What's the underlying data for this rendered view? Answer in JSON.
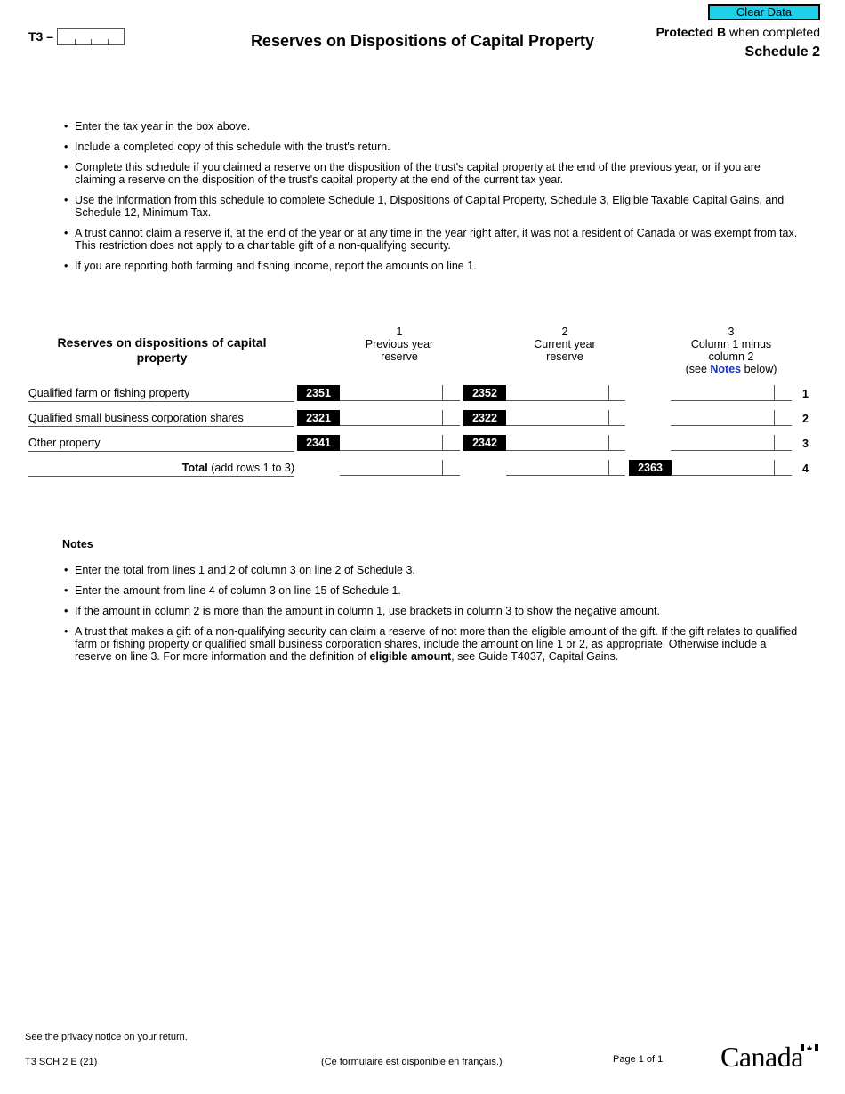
{
  "header": {
    "form_prefix": "T3 –",
    "tax_year_value": "",
    "title": "Reserves on Dispositions of Capital Property",
    "clear_button_label": "Clear Data",
    "protected_bold": "Protected B",
    "protected_rest": " when completed",
    "schedule": "Schedule 2"
  },
  "intro_bullets": [
    "Enter the tax year in the box above.",
    "Include a completed copy of this schedule with the trust's return.",
    "Complete this schedule if you claimed a reserve on the disposition of the trust's capital property at the end of the previous year, or if you are claiming a reserve on the disposition of the trust's capital property at the end of the current tax year.",
    "Use the information from this schedule to complete Schedule 1, Dispositions of Capital Property, Schedule 3, Eligible Taxable Capital Gains, and Schedule 12, Minimum Tax.",
    "A trust cannot claim a reserve if, at the end of the year or at any time in the year right after, it was not a resident of Canada or was exempt from tax. This restriction does not apply to a charitable gift of a non-qualifying security.",
    "If you are reporting both farming and fishing income, report the amounts on line 1."
  ],
  "table": {
    "title": "Reserves on dispositions of capital property",
    "columns": [
      {
        "num": "1",
        "line1": "Previous year",
        "line2": "reserve"
      },
      {
        "num": "2",
        "line1": "Current year",
        "line2": "reserve"
      },
      {
        "num": "3",
        "line1": "Column 1 minus",
        "line2": "column 2",
        "line3_pre": "(see ",
        "line3_link": "Notes",
        "line3_post": " below)"
      }
    ],
    "rows": [
      {
        "label": "Qualified farm or fishing property",
        "code1": "2351",
        "code2": "2352",
        "line": "1",
        "col1": "",
        "col2": "",
        "col3": ""
      },
      {
        "label": "Qualified small business corporation shares",
        "code1": "2321",
        "code2": "2322",
        "line": "2",
        "col1": "",
        "col2": "",
        "col3": ""
      },
      {
        "label": "Other property",
        "code1": "2341",
        "code2": "2342",
        "line": "3",
        "col1": "",
        "col2": "",
        "col3": ""
      }
    ],
    "total": {
      "label_bold": "Total",
      "label_rest": " (add rows 1 to 3)",
      "code3": "2363",
      "line": "4",
      "col1": "",
      "col2": "",
      "col3": ""
    }
  },
  "notes": {
    "title": "Notes",
    "items": [
      "Enter the total from lines 1 and 2 of column 3 on line 2 of Schedule 3.",
      "Enter the amount from line 4 of column 3 on line 15 of Schedule 1.",
      "If the amount in column 2 is more than the amount in column 1, use brackets in column 3 to show the negative amount."
    ],
    "last_item_pre": "A trust that makes a gift of a non-qualifying security can claim a reserve of not more than the eligible amount of the gift. If the gift relates to qualified farm or fishing property or qualified small business corporation shares, include the amount on line 1 or 2, as appropriate. Otherwise include a reserve on line 3. For more information and the definition of ",
    "last_item_bold": "eligible amount",
    "last_item_post": ", see Guide T4037, Capital Gains."
  },
  "footer": {
    "privacy": "See the privacy notice on your return.",
    "form_code": "T3 SCH 2 E (21)",
    "french": "(Ce formulaire est disponible en français.)",
    "page": "Page 1 of 1",
    "wordmark": "Canada"
  }
}
